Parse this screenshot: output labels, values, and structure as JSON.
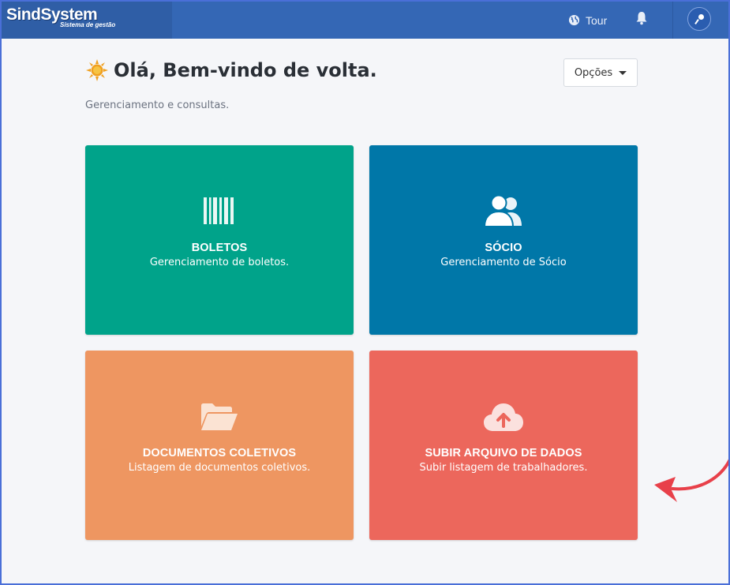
{
  "app": {
    "brand_name": "SindSystem",
    "brand_tagline": "Sistema de gestão"
  },
  "topbar": {
    "tour_label": "Tour",
    "icons": {
      "tour": "globe-icon",
      "notifications": "bell-icon",
      "user": "user-avatar-icon"
    }
  },
  "header": {
    "greeting": "Olá, Bem-vindo de volta.",
    "greeting_icon": "sun-icon",
    "subtitle": "Gerenciamento e consultas.",
    "options_label": "Opções"
  },
  "cards": [
    {
      "id": "boletos",
      "title": "BOLETOS",
      "description": "Gerenciamento de boletos.",
      "icon": "barcode-icon",
      "color": "#00a38a"
    },
    {
      "id": "socio",
      "title": "SÓCIO",
      "description": "Gerenciamento de Sócio",
      "icon": "users-icon",
      "color": "#0077a8"
    },
    {
      "id": "documentos",
      "title": "DOCUMENTOS COLETIVOS",
      "description": "Listagem de documentos coletivos.",
      "icon": "folder-open-icon",
      "color": "#ee9661"
    },
    {
      "id": "subir",
      "title": "SUBIR ARQUIVO DE DADOS",
      "description": "Subir listagem de trabalhadores.",
      "icon": "cloud-upload-icon",
      "color": "#ec675c"
    }
  ],
  "colors": {
    "topbar": "#3467b5",
    "brand_bg": "#2f5ea6",
    "page_bg": "#f5f6f9",
    "annotation_arrow": "#e8404a"
  }
}
